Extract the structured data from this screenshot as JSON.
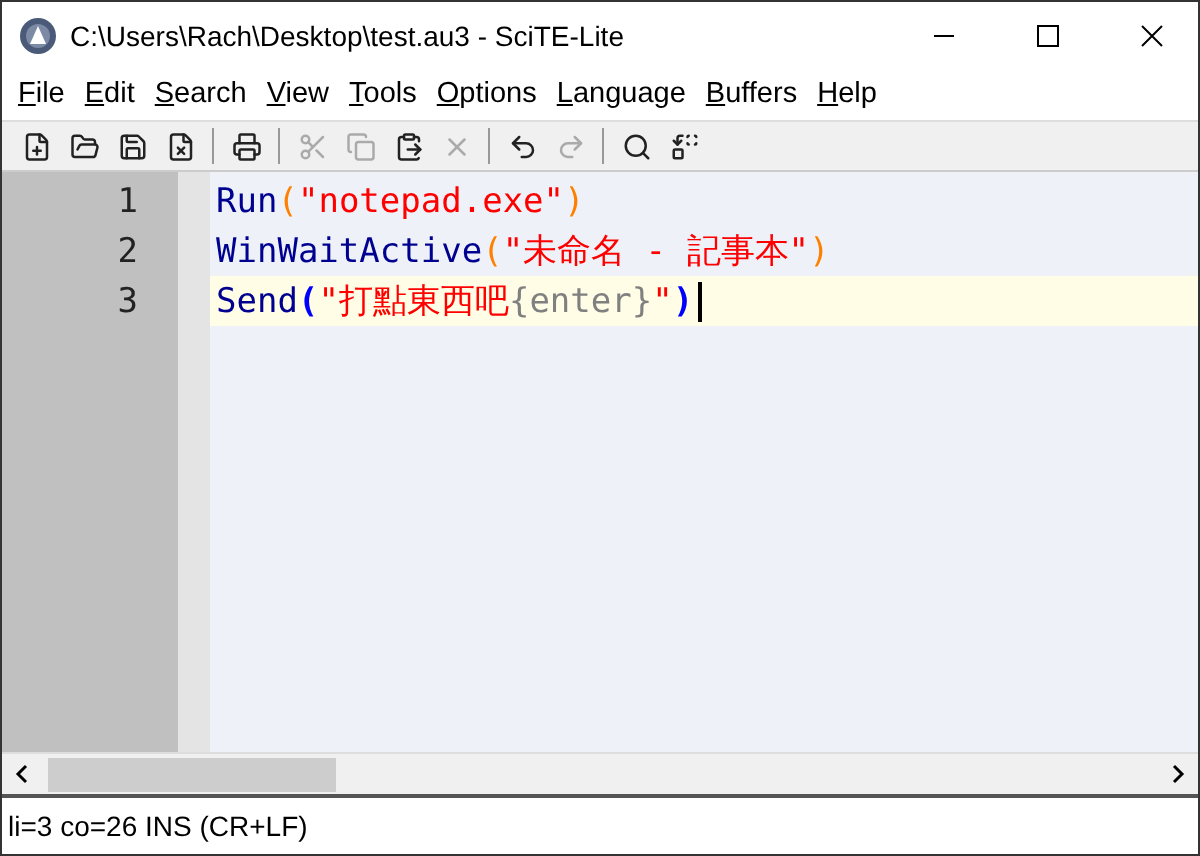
{
  "window": {
    "title": "C:\\Users\\Rach\\Desktop\\test.au3 - SciTE-Lite"
  },
  "menu": [
    "File",
    "Edit",
    "Search",
    "View",
    "Tools",
    "Options",
    "Language",
    "Buffers",
    "Help"
  ],
  "toolbar": [
    {
      "kind": "new",
      "disabled": false
    },
    {
      "kind": "open",
      "disabled": false
    },
    {
      "kind": "save",
      "disabled": false
    },
    {
      "kind": "close",
      "disabled": false
    },
    {
      "kind": "sep"
    },
    {
      "kind": "print",
      "disabled": false
    },
    {
      "kind": "sep"
    },
    {
      "kind": "cut",
      "disabled": true
    },
    {
      "kind": "copy",
      "disabled": true
    },
    {
      "kind": "paste",
      "disabled": false
    },
    {
      "kind": "delete",
      "disabled": true
    },
    {
      "kind": "sep"
    },
    {
      "kind": "undo",
      "disabled": false
    },
    {
      "kind": "redo",
      "disabled": true
    },
    {
      "kind": "sep"
    },
    {
      "kind": "find",
      "disabled": false
    },
    {
      "kind": "replace",
      "disabled": false
    }
  ],
  "editor": {
    "lines": [
      {
        "number": "1",
        "current": false,
        "tokens": [
          {
            "kind": "function",
            "text": "Run"
          },
          {
            "kind": "paren",
            "text": "("
          },
          {
            "kind": "string",
            "text": "\"notepad.exe\""
          },
          {
            "kind": "paren",
            "text": ")"
          }
        ]
      },
      {
        "number": "2",
        "current": false,
        "tokens": [
          {
            "kind": "function",
            "text": "WinWaitActive"
          },
          {
            "kind": "paren",
            "text": "("
          },
          {
            "kind": "string",
            "text": "\"未命名 - 記事本\""
          },
          {
            "kind": "paren",
            "text": ")"
          }
        ]
      },
      {
        "number": "3",
        "current": true,
        "tokens": [
          {
            "kind": "function",
            "text": "Send"
          },
          {
            "kind": "brace",
            "text": "("
          },
          {
            "kind": "string",
            "text": "\"打點東西吧"
          },
          {
            "kind": "sendkey",
            "text": "{enter}"
          },
          {
            "kind": "string",
            "text": "\""
          },
          {
            "kind": "brace",
            "text": ")"
          }
        ]
      }
    ]
  },
  "status_bar": "li=3 co=26 INS (CR+LF)"
}
